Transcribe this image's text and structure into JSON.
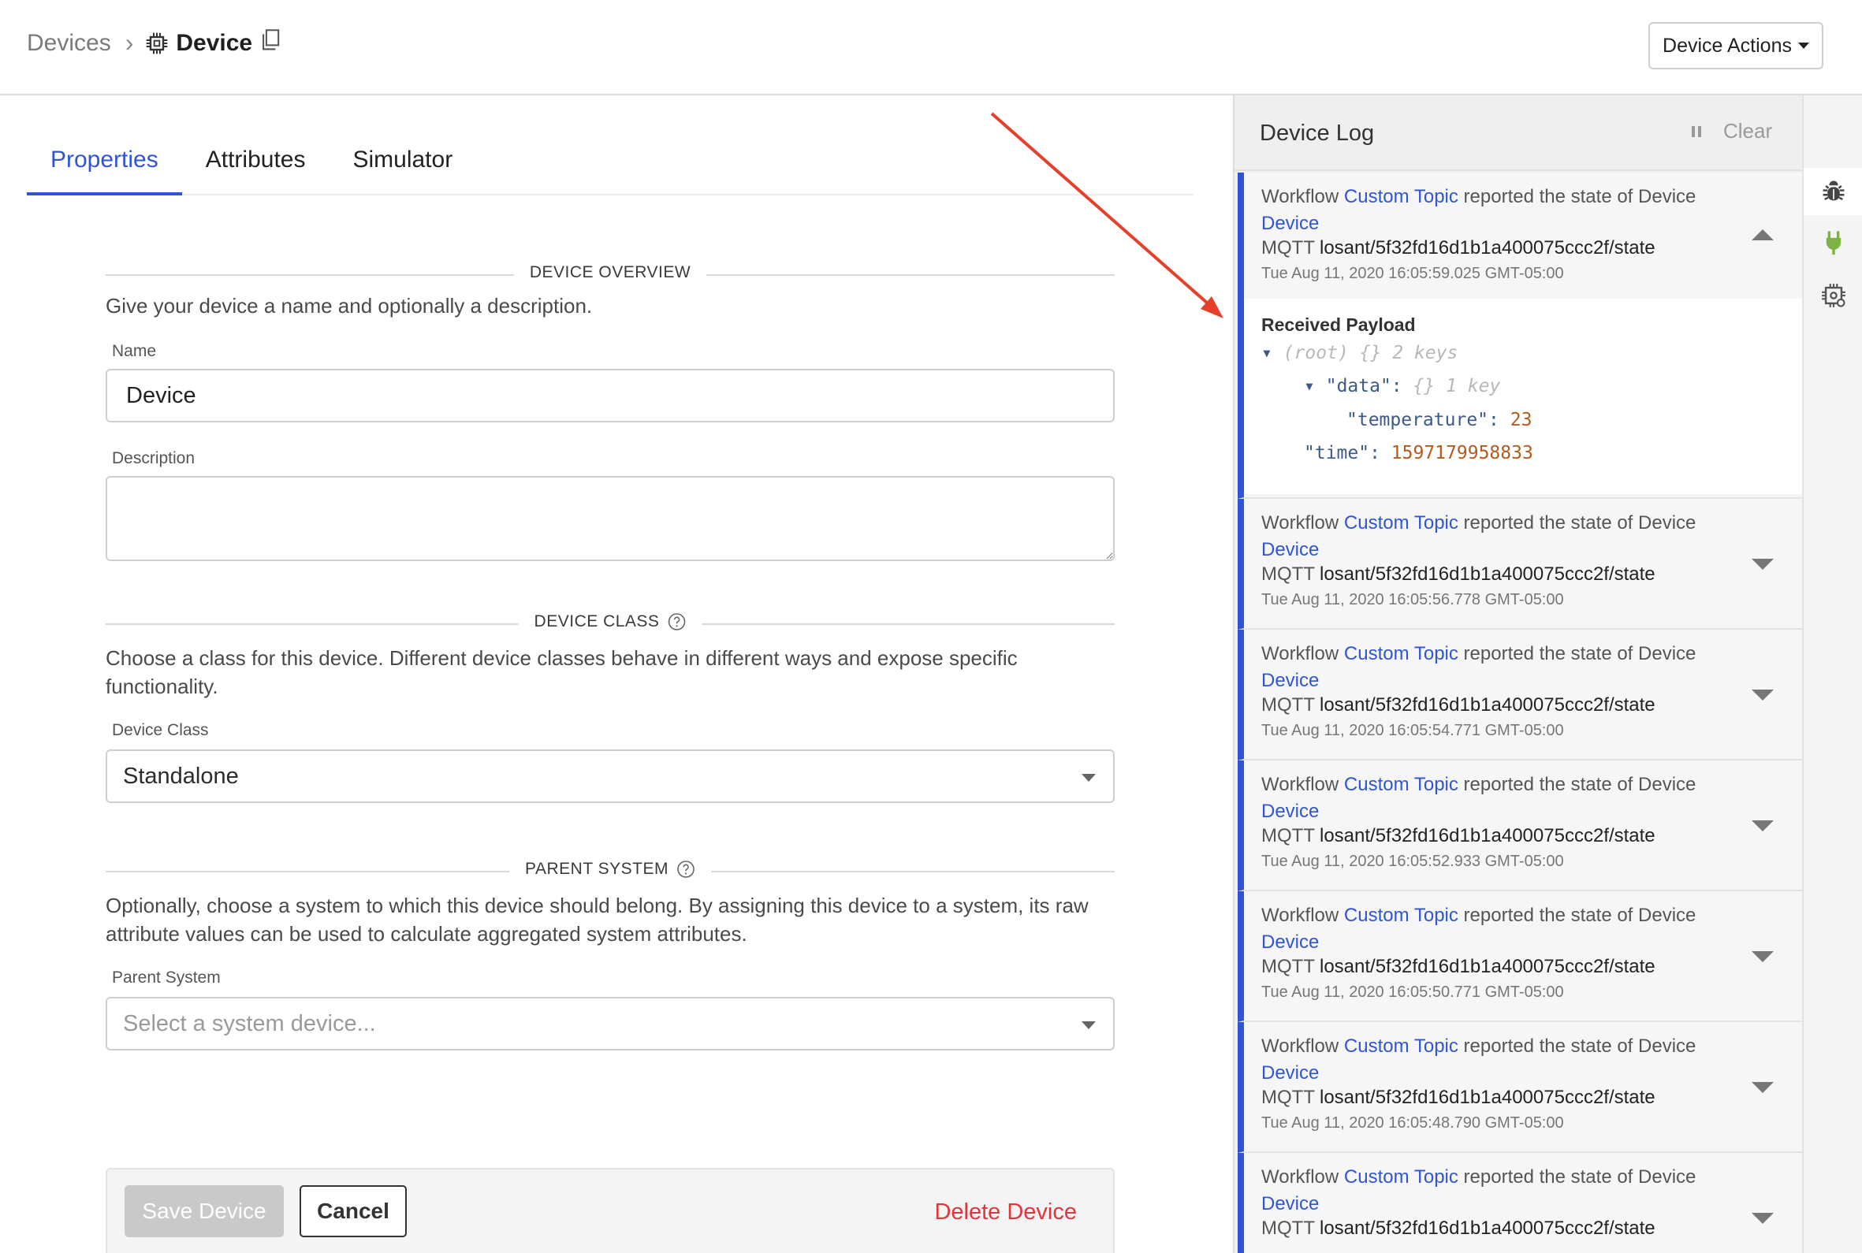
{
  "breadcrumb": {
    "parent": "Devices",
    "separator": "›",
    "current": "Device"
  },
  "header": {
    "actions_label": "Device Actions"
  },
  "tabs": [
    {
      "label": "Properties",
      "active": true
    },
    {
      "label": "Attributes",
      "active": false
    },
    {
      "label": "Simulator",
      "active": false
    }
  ],
  "overview": {
    "heading": "DEVICE OVERVIEW",
    "description": "Give your device a name and optionally a description.",
    "name_label": "Name",
    "name_value": "Device",
    "description_label": "Description",
    "description_value": ""
  },
  "device_class": {
    "heading": "DEVICE CLASS",
    "description": "Choose a class for this device. Different device classes behave in different ways and expose specific functionality.",
    "label": "Device Class",
    "value": "Standalone"
  },
  "parent_system": {
    "heading": "PARENT SYSTEM",
    "description": "Optionally, choose a system to which this device should belong. By assigning this device to a system, its raw attribute values can be used to calculate aggregated system attributes.",
    "label": "Parent System",
    "placeholder": "Select a system device..."
  },
  "form_actions": {
    "save": "Save Device",
    "cancel": "Cancel",
    "delete": "Delete Device"
  },
  "log": {
    "title": "Device Log",
    "clear": "Clear",
    "entries": [
      {
        "prefix": "Workflow",
        "workflow": "Custom Topic",
        "middle": "reported the state of Device",
        "device": "Device",
        "protocol": "MQTT",
        "topic": "losant/5f32fd16d1b1a400075ccc2f/state",
        "time": "Tue Aug 11, 2020 16:05:59.025 GMT-05:00",
        "expanded": true
      },
      {
        "prefix": "Workflow",
        "workflow": "Custom Topic",
        "middle": "reported the state of Device",
        "device": "Device",
        "protocol": "MQTT",
        "topic": "losant/5f32fd16d1b1a400075ccc2f/state",
        "time": "Tue Aug 11, 2020 16:05:56.778 GMT-05:00",
        "expanded": false
      },
      {
        "prefix": "Workflow",
        "workflow": "Custom Topic",
        "middle": "reported the state of Device",
        "device": "Device",
        "protocol": "MQTT",
        "topic": "losant/5f32fd16d1b1a400075ccc2f/state",
        "time": "Tue Aug 11, 2020 16:05:54.771 GMT-05:00",
        "expanded": false
      },
      {
        "prefix": "Workflow",
        "workflow": "Custom Topic",
        "middle": "reported the state of Device",
        "device": "Device",
        "protocol": "MQTT",
        "topic": "losant/5f32fd16d1b1a400075ccc2f/state",
        "time": "Tue Aug 11, 2020 16:05:52.933 GMT-05:00",
        "expanded": false
      },
      {
        "prefix": "Workflow",
        "workflow": "Custom Topic",
        "middle": "reported the state of Device",
        "device": "Device",
        "protocol": "MQTT",
        "topic": "losant/5f32fd16d1b1a400075ccc2f/state",
        "time": "Tue Aug 11, 2020 16:05:50.771 GMT-05:00",
        "expanded": false
      },
      {
        "prefix": "Workflow",
        "workflow": "Custom Topic",
        "middle": "reported the state of Device",
        "device": "Device",
        "protocol": "MQTT",
        "topic": "losant/5f32fd16d1b1a400075ccc2f/state",
        "time": "Tue Aug 11, 2020 16:05:48.790 GMT-05:00",
        "expanded": false
      },
      {
        "prefix": "Workflow",
        "workflow": "Custom Topic",
        "middle": "reported the state of Device",
        "device": "Device",
        "protocol": "MQTT",
        "topic": "losant/5f32fd16d1b1a400075ccc2f/state",
        "time": "",
        "expanded": false
      }
    ],
    "payload": {
      "title": "Received Payload",
      "root_label": "(root)",
      "root_braces": "{}",
      "root_count": "2 keys",
      "data_key": "\"data\":",
      "data_braces": "{}",
      "data_count": "1 key",
      "temperature_key": "\"temperature\":",
      "temperature_value": "23",
      "time_key": "\"time\":",
      "time_value": "1597179958833"
    }
  },
  "colors": {
    "accent": "#2f55d4",
    "danger": "#e0353b",
    "json_number": "#b55a1c",
    "rail_plug": "#7cb342",
    "annotation_arrow": "#e5402a"
  },
  "icons": {
    "breadcrumb": "chip-icon",
    "copy": "copy-icon",
    "help": "help-circle-icon",
    "pause": "pause-icon",
    "rail": [
      "bug-icon",
      "plug-icon",
      "chip-settings-icon"
    ]
  }
}
